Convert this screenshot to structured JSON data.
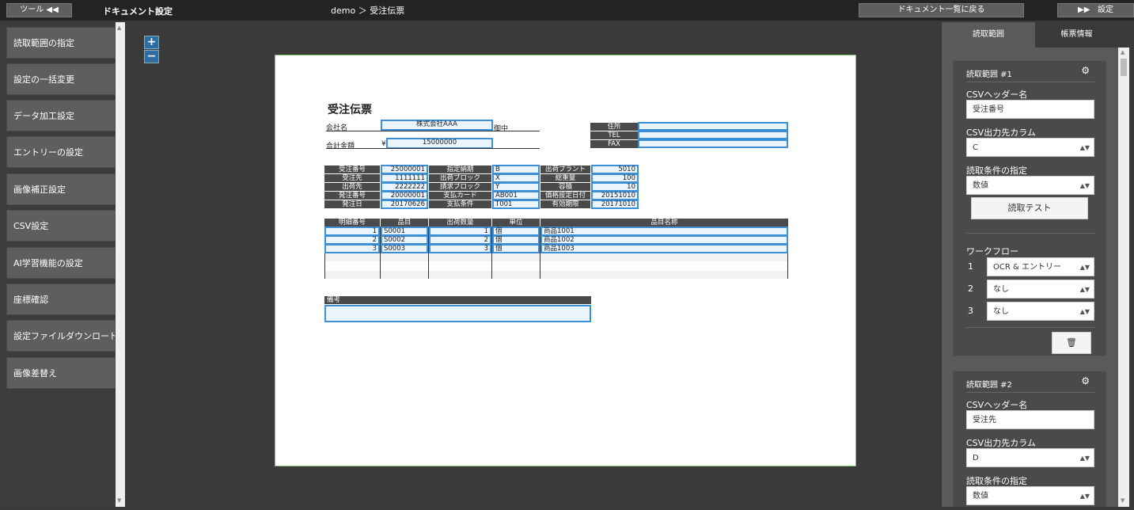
{
  "topbar": {
    "tool_label": "ツール ◀◀",
    "doc_title": "ドキュメント設定",
    "breadcrumb": "demo ＞ 受注伝票",
    "back_label": "ドキュメント一覧に戻る",
    "settings_label": "設定"
  },
  "sidebar": {
    "items": [
      "読取範囲の指定",
      "設定の一括変更",
      "データ加工設定",
      "エントリーの設定",
      "画像補正設定",
      "CSV設定",
      "AI学習機能の設定",
      "座標確認",
      "設定ファイルダウンロード",
      "画像差替え"
    ]
  },
  "zoom": {
    "plus": "+",
    "minus": "−"
  },
  "form": {
    "title": "受注伝票",
    "company_label": "会社名",
    "company_value": "株式会社AAA",
    "company_suffix": "御中",
    "amount_label": "合計金額",
    "yen": "¥",
    "amount_value": "15000000",
    "addr_labels": [
      "住所",
      "TEL",
      "FAX"
    ],
    "info_rows": [
      [
        "受注番号",
        "25000001",
        "指定納期",
        "B",
        "出荷プラント",
        "5010"
      ],
      [
        "受注先",
        "1111111",
        "出荷ブロック",
        "X",
        "総重量",
        "100"
      ],
      [
        "出荷先",
        "2222222",
        "請求ブロック",
        "Y",
        "容積",
        "10"
      ],
      [
        "発注番号",
        "20000001",
        "支払カード",
        "AB001",
        "価格設定日付",
        "20151010"
      ],
      [
        "発注日",
        "20170626",
        "支払条件",
        "T001",
        "有効期限",
        "20171010"
      ]
    ],
    "detail_headers": [
      "明細番号",
      "品目",
      "出荷数量",
      "単位",
      "品目名称"
    ],
    "detail_rows": [
      [
        "1",
        "S0001",
        "1",
        "個",
        "商品1001"
      ],
      [
        "2",
        "S0002",
        "2",
        "個",
        "商品1002"
      ],
      [
        "3",
        "S0003",
        "3",
        "個",
        "商品1003"
      ]
    ],
    "remarks_label": "備考"
  },
  "right": {
    "tabs": [
      "読取範囲",
      "帳票情報"
    ],
    "cards": [
      {
        "title": "読取範囲 #1",
        "csv_header_label": "CSVヘッダー名",
        "csv_header_value": "受注番号",
        "csv_col_label": "CSV出力先カラム",
        "csv_col_value": "C",
        "cond_label": "読取条件の指定",
        "cond_value": "数値",
        "test_label": "読取テスト",
        "workflow_label": "ワークフロー",
        "workflow": [
          {
            "n": "1",
            "value": "OCR & エントリー"
          },
          {
            "n": "2",
            "value": "なし"
          },
          {
            "n": "3",
            "value": "なし"
          }
        ],
        "trash_icon": "🗑"
      },
      {
        "title": "読取範囲 #2",
        "csv_header_label": "CSVヘッダー名",
        "csv_header_value": "受注先",
        "csv_col_label": "CSV出力先カラム",
        "csv_col_value": "D",
        "cond_label": "読取条件の指定",
        "cond_value": "数値"
      }
    ]
  }
}
